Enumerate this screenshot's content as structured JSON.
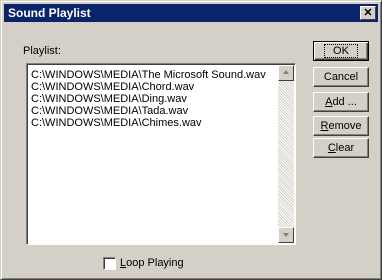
{
  "window": {
    "title": "Sound Playlist",
    "close_glyph": "✕"
  },
  "playlist": {
    "label": "Playlist:",
    "items": [
      "C:\\WINDOWS\\MEDIA\\The Microsoft Sound.wav",
      "C:\\WINDOWS\\MEDIA\\Chord.wav",
      "C:\\WINDOWS\\MEDIA\\Ding.wav",
      "C:\\WINDOWS\\MEDIA\\Tada.wav",
      "C:\\WINDOWS\\MEDIA\\Chimes.wav"
    ]
  },
  "buttons": {
    "ok": "OK",
    "cancel": "Cancel",
    "add_hot": "A",
    "add_rest": "dd ...",
    "remove_hot": "R",
    "remove_rest": "emove",
    "clear_hot": "C",
    "clear_rest": "lear"
  },
  "loop": {
    "label_hot": "L",
    "label_rest": "oop Playing",
    "checked": false
  },
  "colors": {
    "titlebar": "#0a246a",
    "face": "#d4d0c8"
  }
}
